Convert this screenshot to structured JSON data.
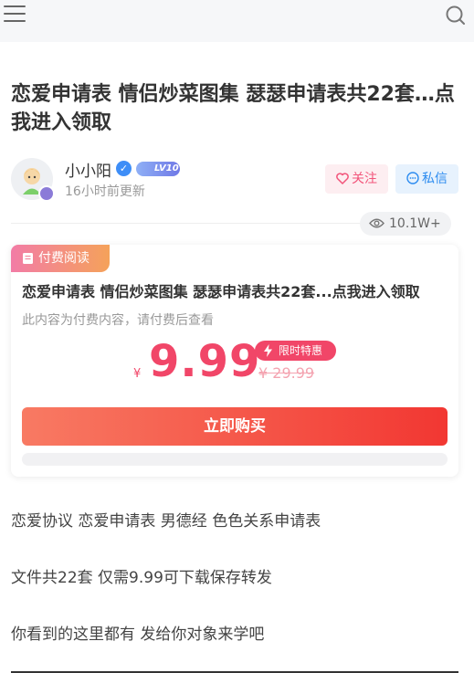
{
  "header": {
    "menu_icon": "hamburger-menu-icon",
    "search_icon": "search-icon"
  },
  "article": {
    "title": "恋爱申请表 情侣炒菜图集 瑟瑟申请表共22套…点我进入领取",
    "author": {
      "name": "小小阳",
      "level": "LV10",
      "updated": "16小时前更新"
    },
    "actions": {
      "follow": "关注",
      "message": "私信"
    },
    "views": "10.1W+"
  },
  "paywall": {
    "tag": "付费阅读",
    "title": "恋爱申请表 情侣炒菜图集 瑟瑟申请表共22套...点我进入领取",
    "hint": "此内容为付费内容，请付费后查看",
    "currency": "¥",
    "price": "9.99",
    "limited_label": "限时特惠",
    "original_price": "¥ 29.99",
    "buy_label": "立即购买"
  },
  "body": {
    "paragraphs": [
      "恋爱协议 恋爱申请表 男德经 色色关系申请表",
      "文件共22套 仅需9.99可下载保存转发",
      "你看到的这里都有 发给你对象来学吧"
    ]
  },
  "colors": {
    "accent": "#f14668",
    "brand_blue": "#2d8cf0",
    "buy_gradient_end": "#f23732"
  }
}
